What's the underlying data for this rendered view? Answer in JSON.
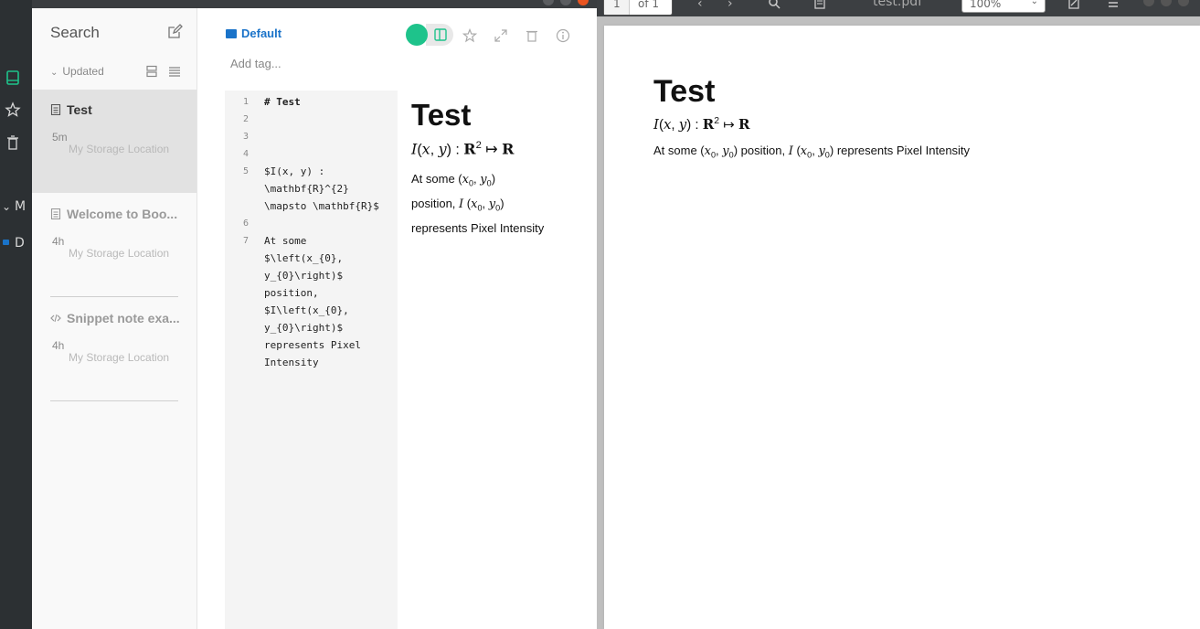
{
  "nav": {
    "collapsed_labels": [
      "M",
      "D"
    ]
  },
  "notelist": {
    "search_label": "Search",
    "sort_label": "Updated",
    "notes": [
      {
        "title": "Test",
        "time": "5m",
        "location": "My Storage Location"
      },
      {
        "title": "Welcome to Boo...",
        "time": "4h",
        "location": "My Storage Location"
      },
      {
        "title": "Snippet note exa...",
        "time": "4h",
        "location": "My Storage Location"
      }
    ]
  },
  "editor": {
    "folder": "Default",
    "add_tag_placeholder": "Add tag...",
    "line_numbers": [
      "1",
      "2",
      "3",
      "4",
      "5",
      "6",
      "7"
    ],
    "code": {
      "l1": "# Test",
      "l5a": "$I(x, y) :",
      "l5b": "\\mathbf{R}^{2}",
      "l5c": "\\mapsto \\mathbf{R}$",
      "l7a": "At some",
      "l7b": "$\\left(x_{0},",
      "l7c": "y_{0}\\right)$",
      "l7d": "position,",
      "l7e": "$I\\left(x_{0},",
      "l7f": "y_{0}\\right)$",
      "l7g": "represents Pixel",
      "l7h": "Intensity"
    }
  },
  "preview": {
    "title": "Test",
    "text_at_some": "At some",
    "text_position": "position,",
    "text_represents": "represents Pixel Intensity"
  },
  "pdf": {
    "page_current": "1",
    "page_of": "of 1",
    "filename": "test.pdf",
    "zoom": "100%",
    "title": "Test",
    "text_at_some": "At some",
    "text_position": "position,",
    "text_represents": "represents Pixel Intensity"
  },
  "colors": {
    "accent_green": "#1ec38b",
    "folder_blue": "#1a73c9",
    "close_orange": "#e95420"
  }
}
